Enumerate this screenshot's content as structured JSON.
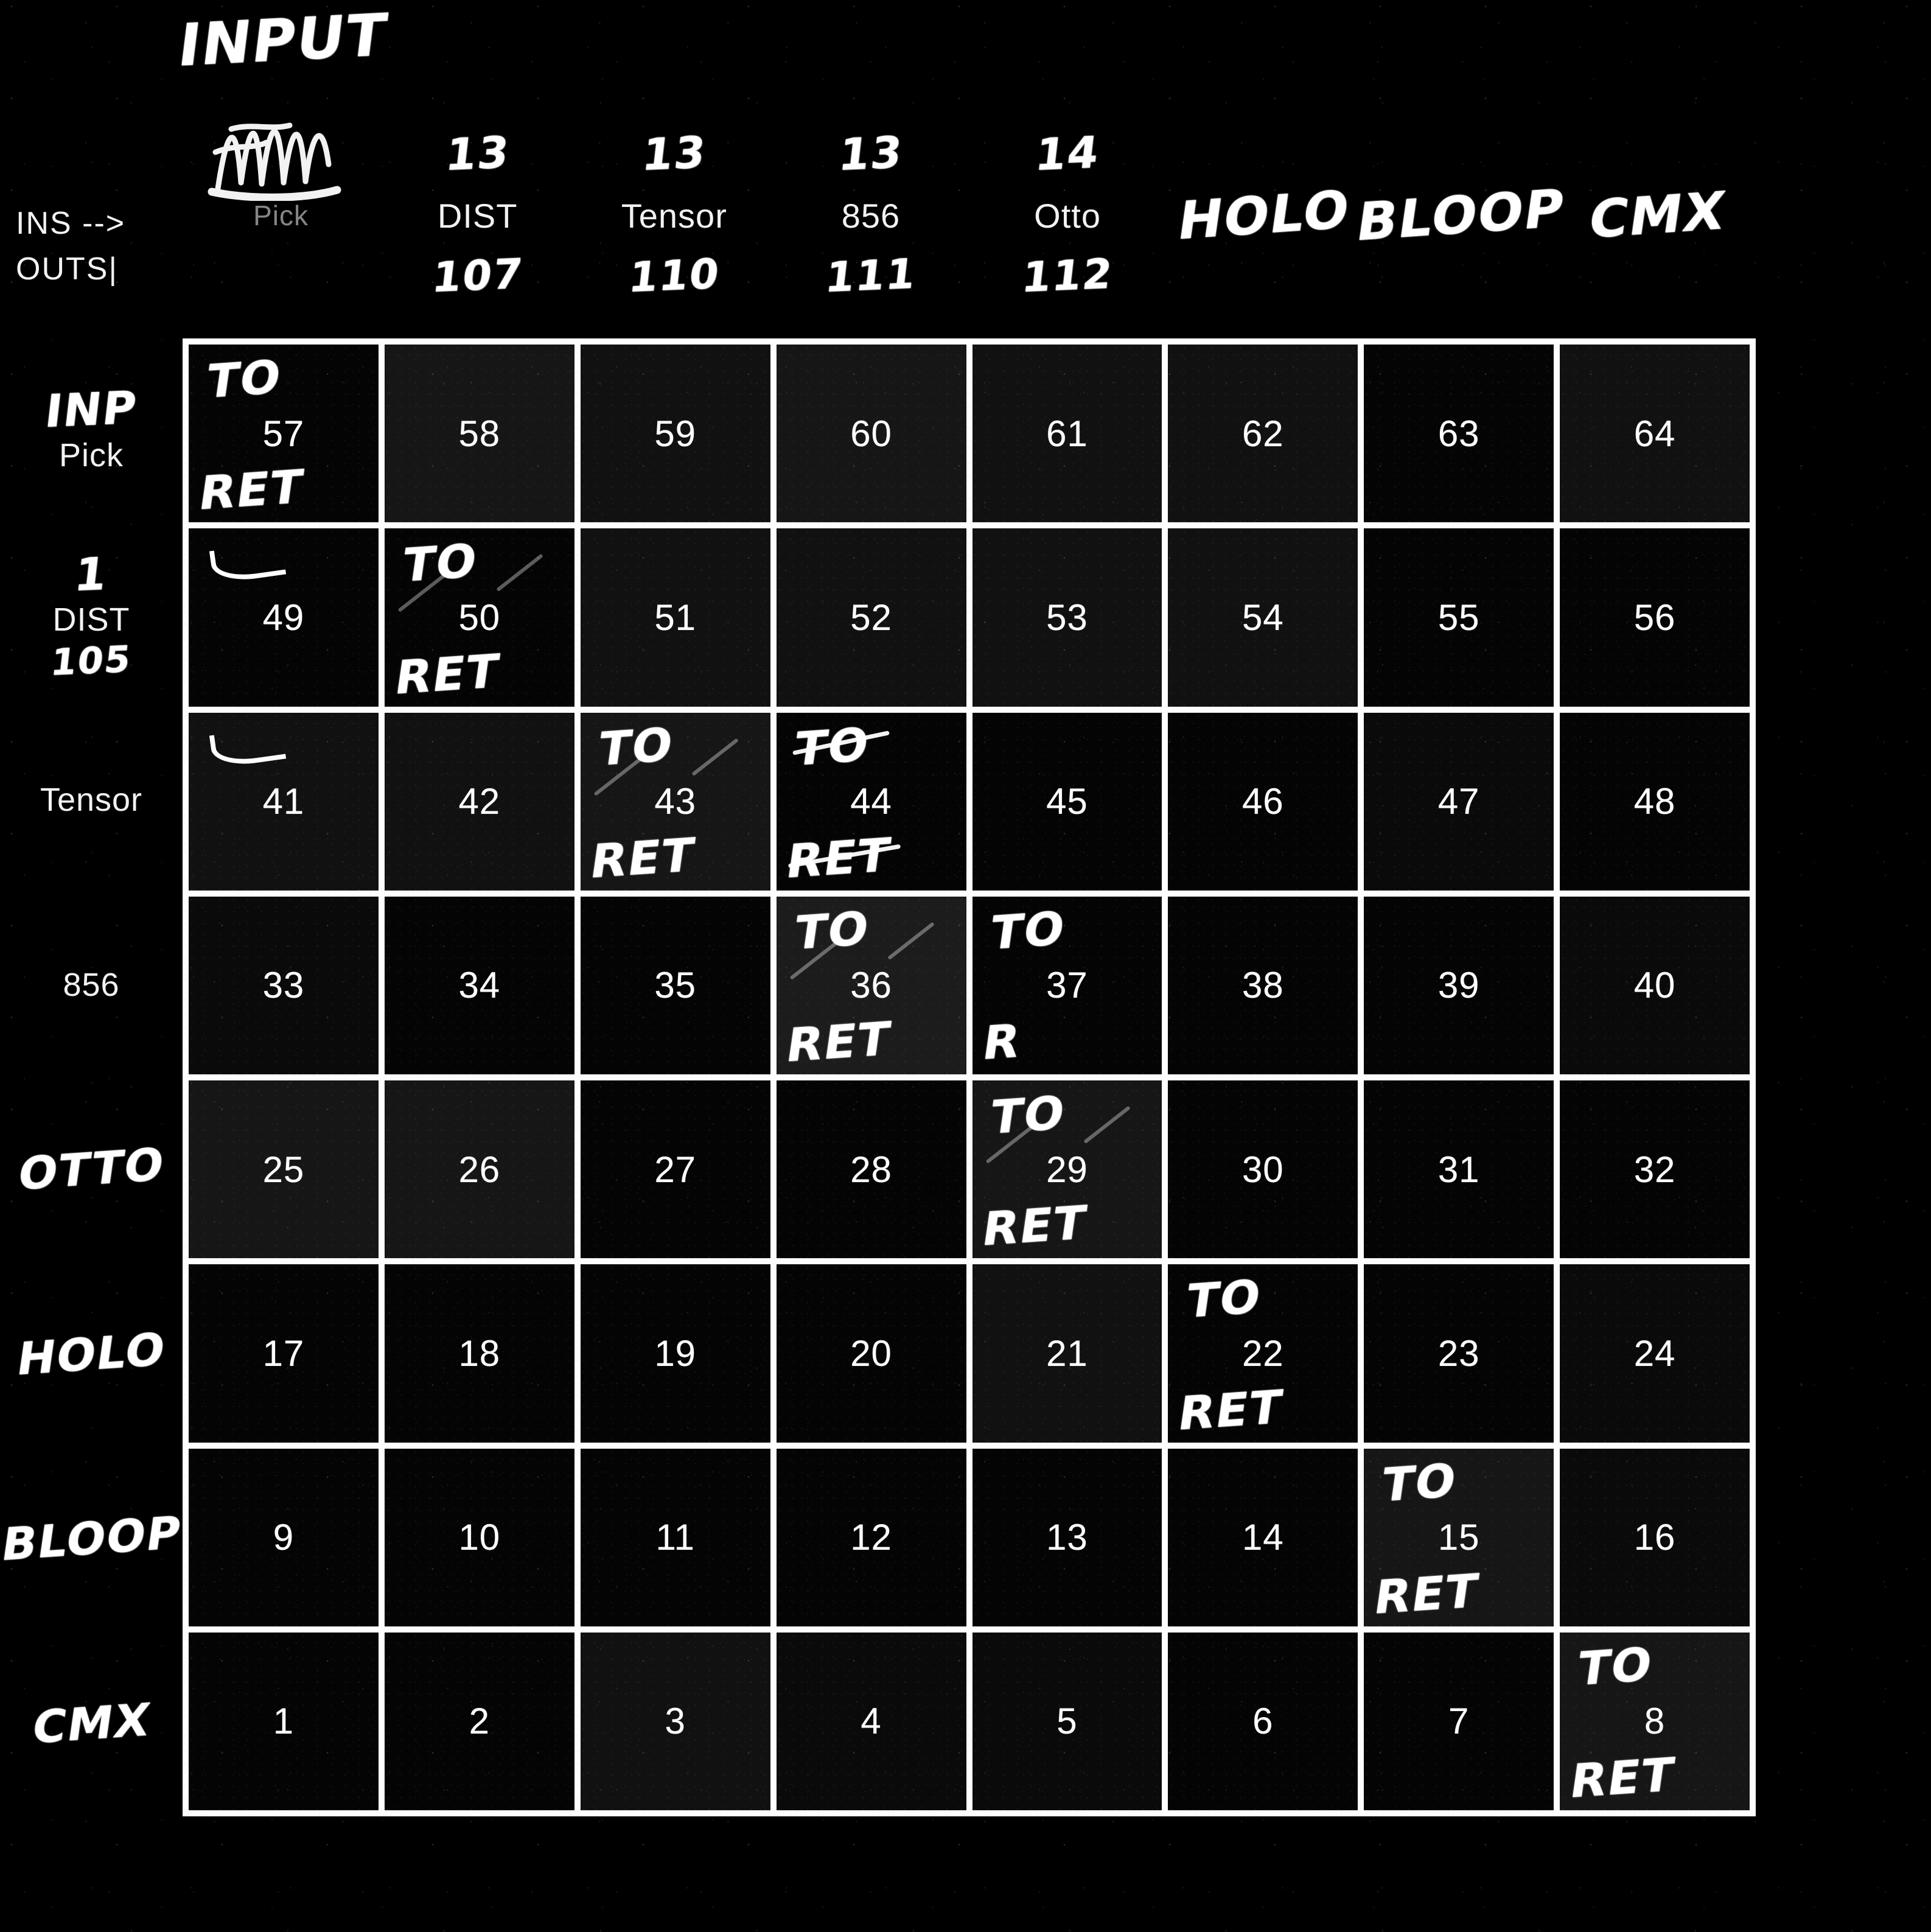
{
  "legend": {
    "ins_label": "INS -->",
    "outs_label": "OUTS|"
  },
  "header": {
    "input_scrawl": "INPUT",
    "scribble_label": "Pick"
  },
  "columns": [
    {
      "top": "",
      "label": "Pick",
      "bottom": "",
      "style": "scribble"
    },
    {
      "top": "13",
      "label": "DIST",
      "bottom": "107",
      "style": "plain"
    },
    {
      "top": "13",
      "label": "Tensor",
      "bottom": "110",
      "style": "plain"
    },
    {
      "top": "13",
      "label": "856",
      "bottom": "111",
      "style": "plain"
    },
    {
      "top": "14",
      "label": "Otto",
      "bottom": "112",
      "style": "plain"
    },
    {
      "top": "",
      "label": "HOLO",
      "bottom": "",
      "style": "hand"
    },
    {
      "top": "",
      "label": "BLOOP",
      "bottom": "",
      "style": "hand"
    },
    {
      "top": "",
      "label": "CMX",
      "bottom": "",
      "style": "hand"
    }
  ],
  "rows": [
    {
      "top": "INP",
      "label": "Pick",
      "bottom": "",
      "style": "mixed"
    },
    {
      "top": "1",
      "label": "DIST",
      "bottom": "105",
      "style": "mixed"
    },
    {
      "top": "",
      "label": "Tensor",
      "bottom": "",
      "style": "plain"
    },
    {
      "top": "",
      "label": "856",
      "bottom": "",
      "style": "plain"
    },
    {
      "top": "",
      "label": "OTTO",
      "bottom": "",
      "style": "hand"
    },
    {
      "top": "",
      "label": "HOLO",
      "bottom": "",
      "style": "hand"
    },
    {
      "top": "",
      "label": "BLOOP",
      "bottom": "",
      "style": "hand"
    },
    {
      "top": "",
      "label": "CMX",
      "bottom": "",
      "style": "hand"
    }
  ],
  "annotation_labels": {
    "to": "TO",
    "ret": "RET",
    "ret_partial": "R"
  },
  "grid": {
    "rows": 8,
    "cols": 8,
    "cells": [
      [
        {
          "n": "57",
          "to": true,
          "ret": true,
          "tone": 0
        },
        {
          "n": "58",
          "tone": 3
        },
        {
          "n": "59",
          "tone": 2
        },
        {
          "n": "60",
          "tone": 3
        },
        {
          "n": "61",
          "tone": 2
        },
        {
          "n": "62",
          "tone": 2
        },
        {
          "n": "63",
          "tone": 0
        },
        {
          "n": "64",
          "tone": 2
        }
      ],
      [
        {
          "n": "49",
          "swoosh": true,
          "tone": 0
        },
        {
          "n": "50",
          "to": true,
          "ret": true,
          "slash": true,
          "tone": 0
        },
        {
          "n": "51",
          "tone": 2
        },
        {
          "n": "52",
          "tone": 2
        },
        {
          "n": "53",
          "tone": 2
        },
        {
          "n": "54",
          "tone": 2
        },
        {
          "n": "55",
          "tone": 0
        },
        {
          "n": "56",
          "tone": 0
        }
      ],
      [
        {
          "n": "41",
          "swoosh": true,
          "tone": 2
        },
        {
          "n": "42",
          "tone": 2
        },
        {
          "n": "43",
          "to": true,
          "ret": true,
          "slash": true,
          "tone": 3
        },
        {
          "n": "44",
          "to": true,
          "ret": true,
          "struck": true,
          "tone": 0
        },
        {
          "n": "45",
          "tone": 0
        },
        {
          "n": "46",
          "tone": 0
        },
        {
          "n": "47",
          "tone": 1
        },
        {
          "n": "48",
          "tone": 0
        }
      ],
      [
        {
          "n": "33",
          "tone": 1
        },
        {
          "n": "34",
          "tone": 0
        },
        {
          "n": "35",
          "tone": 0
        },
        {
          "n": "36",
          "to": true,
          "ret": true,
          "slash": true,
          "tone": 4
        },
        {
          "n": "37",
          "to": true,
          "ret_partial": true,
          "tone": 0
        },
        {
          "n": "38",
          "tone": 0
        },
        {
          "n": "39",
          "tone": 0
        },
        {
          "n": "40",
          "tone": 1
        }
      ],
      [
        {
          "n": "25",
          "tone": 3
        },
        {
          "n": "26",
          "tone": 3
        },
        {
          "n": "27",
          "tone": 0
        },
        {
          "n": "28",
          "tone": 0
        },
        {
          "n": "29",
          "to": true,
          "ret": true,
          "slash": true,
          "tone": 3
        },
        {
          "n": "30",
          "tone": 0
        },
        {
          "n": "31",
          "tone": 0
        },
        {
          "n": "32",
          "tone": 0
        }
      ],
      [
        {
          "n": "17",
          "tone": 0
        },
        {
          "n": "18",
          "tone": 0
        },
        {
          "n": "19",
          "tone": 0
        },
        {
          "n": "20",
          "tone": 0
        },
        {
          "n": "21",
          "tone": 2
        },
        {
          "n": "22",
          "to": true,
          "ret": true,
          "tone": 0
        },
        {
          "n": "23",
          "tone": 0
        },
        {
          "n": "24",
          "tone": 1
        }
      ],
      [
        {
          "n": "9",
          "tone": 0
        },
        {
          "n": "10",
          "tone": 0
        },
        {
          "n": "11",
          "tone": 0
        },
        {
          "n": "12",
          "tone": 0
        },
        {
          "n": "13",
          "tone": 0
        },
        {
          "n": "14",
          "tone": 0
        },
        {
          "n": "15",
          "to": true,
          "ret": true,
          "tone": 3
        },
        {
          "n": "16",
          "tone": 1
        }
      ],
      [
        {
          "n": "1",
          "tone": 0
        },
        {
          "n": "2",
          "tone": 0
        },
        {
          "n": "3",
          "tone": 2
        },
        {
          "n": "4",
          "tone": 1
        },
        {
          "n": "5",
          "tone": 1
        },
        {
          "n": "6",
          "tone": 0
        },
        {
          "n": "7",
          "tone": 0
        },
        {
          "n": "8",
          "to": true,
          "ret": true,
          "tone": 3
        }
      ]
    ]
  }
}
